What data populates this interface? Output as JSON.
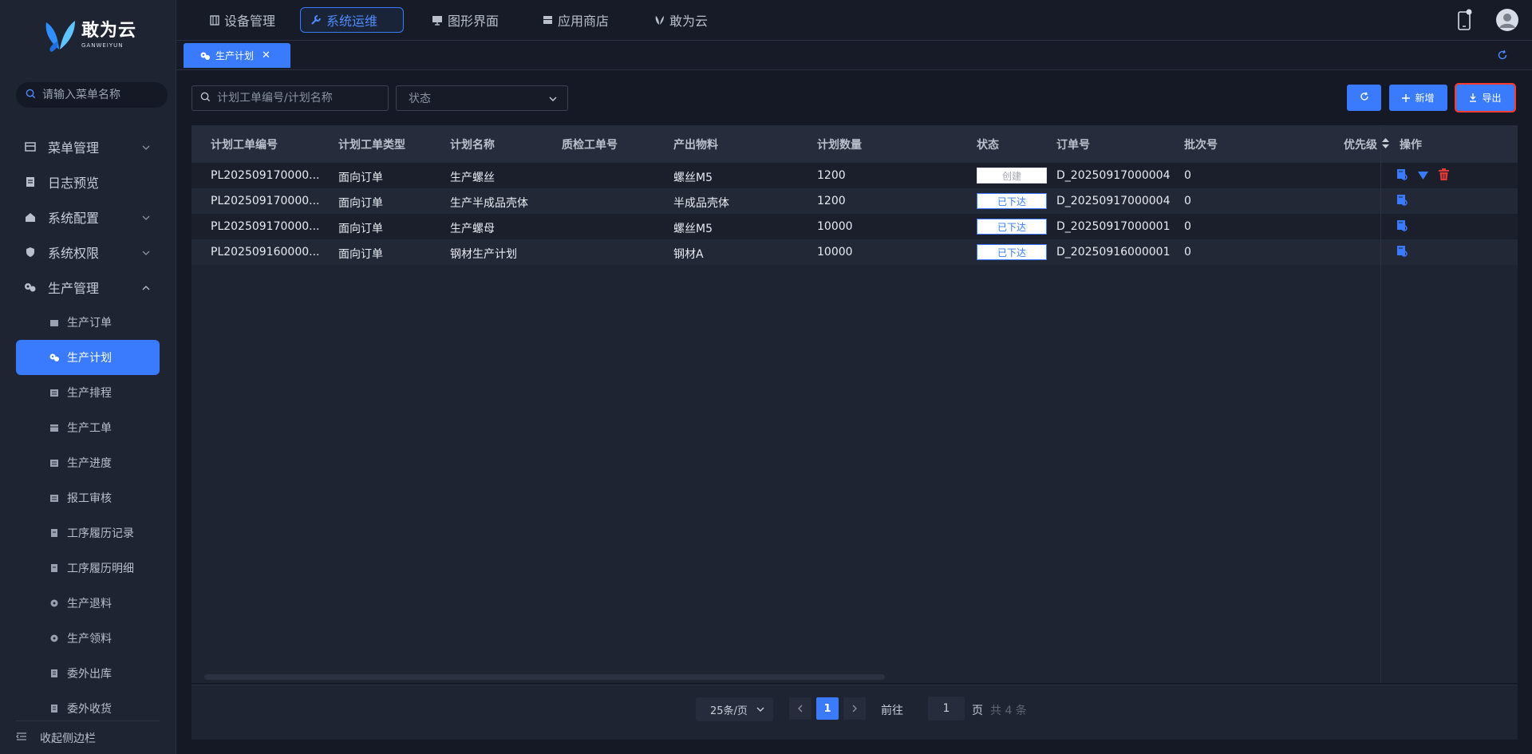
{
  "app": {
    "logo_cn": "敢为云",
    "logo_en": "GANWEIYUN"
  },
  "sidebar": {
    "search_placeholder": "请输入菜单名称",
    "items": [
      {
        "label": "菜单管理",
        "icon": "table-icon",
        "expandable": true
      },
      {
        "label": "日志预览",
        "icon": "document-icon",
        "expandable": false
      },
      {
        "label": "系统配置",
        "icon": "home-icon",
        "expandable": true
      },
      {
        "label": "系统权限",
        "icon": "shield-icon",
        "expandable": true
      },
      {
        "label": "生产管理",
        "icon": "gears-icon",
        "expandable": true,
        "expanded": true
      }
    ],
    "sub_items": [
      {
        "label": "生产订单",
        "icon": "basket-icon"
      },
      {
        "label": "生产计划",
        "icon": "gears-icon",
        "active": true
      },
      {
        "label": "生产排程",
        "icon": "list-icon"
      },
      {
        "label": "生产工单",
        "icon": "calendar-icon"
      },
      {
        "label": "生产进度",
        "icon": "list-icon"
      },
      {
        "label": "报工审核",
        "icon": "list-icon"
      },
      {
        "label": "工序履历记录",
        "icon": "clipboard-icon"
      },
      {
        "label": "工序履历明细",
        "icon": "clipboard-icon"
      },
      {
        "label": "生产退料",
        "icon": "gears-icon"
      },
      {
        "label": "生产领料",
        "icon": "gears-icon"
      },
      {
        "label": "委外出库",
        "icon": "note-icon"
      },
      {
        "label": "委外收货",
        "icon": "note-icon"
      }
    ],
    "collapse_label": "收起侧边栏"
  },
  "topnav": {
    "tabs": [
      {
        "label": "设备管理",
        "icon": "device-icon"
      },
      {
        "label": "系统运维",
        "icon": "wrench-icon",
        "active": true
      },
      {
        "label": "图形界面",
        "icon": "monitor-icon"
      },
      {
        "label": "应用商店",
        "icon": "store-icon"
      },
      {
        "label": "敢为云",
        "icon": "butterfly-icon"
      }
    ]
  },
  "tagsbar": {
    "tag_label": "生产计划"
  },
  "filters": {
    "search_placeholder": "计划工单编号/计划名称",
    "status_placeholder": "状态"
  },
  "toolbar": {
    "add_label": "新增",
    "export_label": "导出"
  },
  "table": {
    "headers": [
      "计划工单编号",
      "计划工单类型",
      "计划名称",
      "质检工单号",
      "产出物料",
      "计划数量",
      "状态",
      "订单号",
      "批次号",
      "优先级",
      "操作"
    ],
    "rows": [
      {
        "code": "PL202509170000...",
        "type": "面向订单",
        "name": "生产螺丝",
        "qc": "",
        "material": "螺丝M5",
        "qty": "1200",
        "status": "创建",
        "status_kind": "created",
        "order": "D_20250917000004",
        "batch": "0",
        "priority": ""
      },
      {
        "code": "PL202509170000...",
        "type": "面向订单",
        "name": "生产半成品壳体",
        "qc": "",
        "material": "半成品壳体",
        "qty": "1200",
        "status": "已下达",
        "status_kind": "issued",
        "order": "D_20250917000004",
        "batch": "0",
        "priority": ""
      },
      {
        "code": "PL202509170000...",
        "type": "面向订单",
        "name": "生产螺母",
        "qc": "",
        "material": "螺丝M5",
        "qty": "10000",
        "status": "已下达",
        "status_kind": "issued",
        "order": "D_20250917000001",
        "batch": "0",
        "priority": ""
      },
      {
        "code": "PL202509160000...",
        "type": "面向订单",
        "name": "钢材生产计划",
        "qc": "",
        "material": "钢材A",
        "qty": "10000",
        "status": "已下达",
        "status_kind": "issued",
        "order": "D_20250916000001",
        "batch": "0",
        "priority": ""
      }
    ]
  },
  "pager": {
    "page_size": "25条/页",
    "current_page": "1",
    "goto_label": "前往",
    "goto_value": "1",
    "page_suffix": "页",
    "total": "共 4 条"
  },
  "colors": {
    "accent": "#3a7bfd",
    "danger": "#e53935",
    "bg": "#141925",
    "panel": "#1f2432"
  }
}
